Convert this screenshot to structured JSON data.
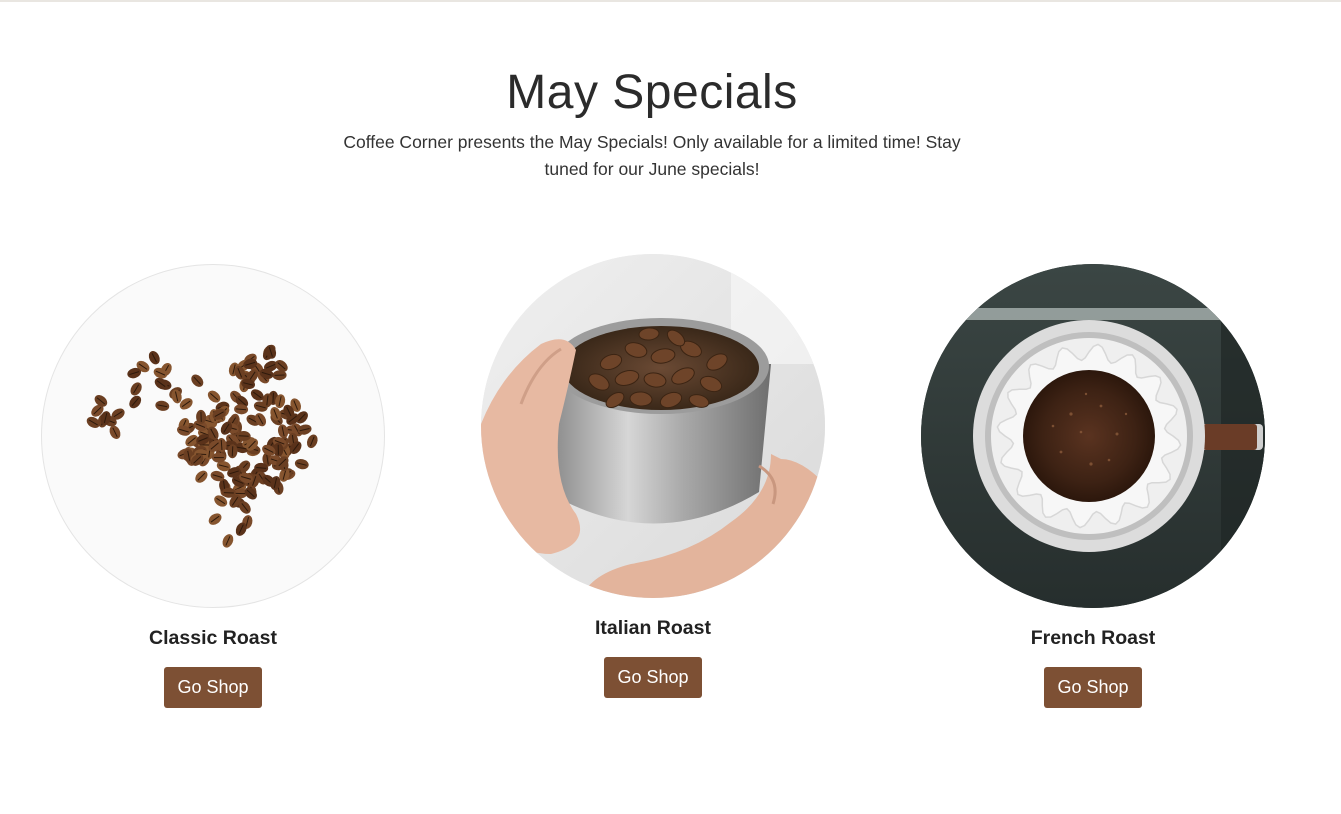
{
  "header": {
    "title": "May Specials",
    "subtitle": "Coffee Corner presents the May Specials! Only available for a limited time! Stay tuned for our June specials!"
  },
  "products": [
    {
      "name": "Classic Roast",
      "button_label": "Go Shop",
      "image": "coffee-beans-scattered"
    },
    {
      "name": "Italian Roast",
      "button_label": "Go Shop",
      "image": "hand-holding-tin-of-beans"
    },
    {
      "name": "French Roast",
      "button_label": "Go Shop",
      "image": "pour-over-filter-with-grounds"
    }
  ],
  "colors": {
    "button_bg": "#7d5034",
    "button_text": "#ffffff",
    "title_text": "#2b2b2b"
  }
}
